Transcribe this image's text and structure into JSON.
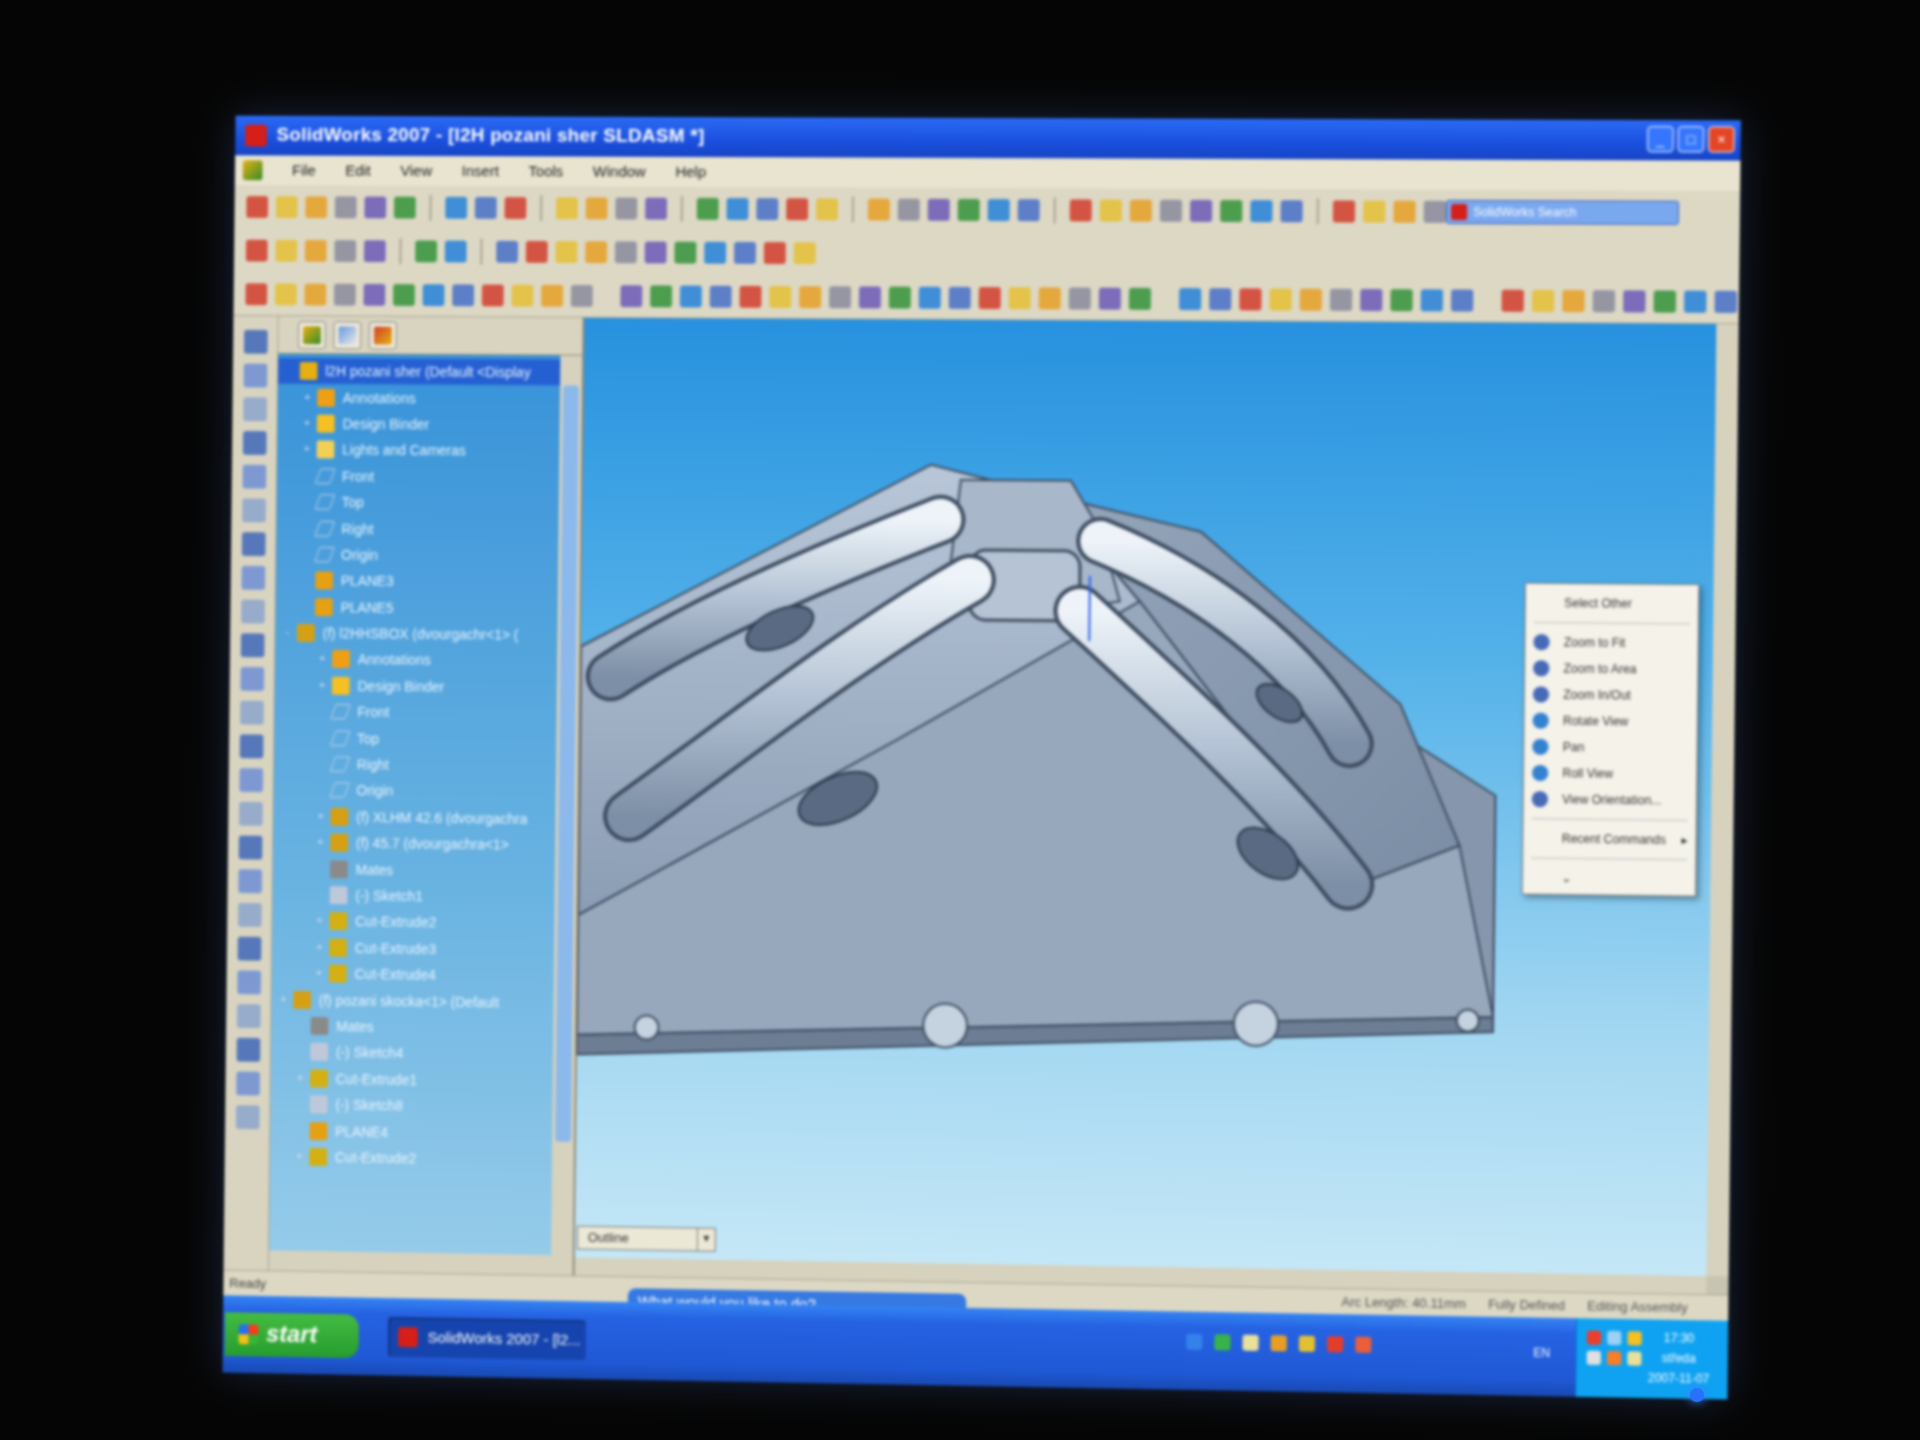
{
  "window": {
    "title": "SolidWorks 2007 - [l2H pozani sher SLDASM *]",
    "controls": [
      "_",
      "□",
      "×"
    ]
  },
  "menu": [
    "File",
    "Edit",
    "View",
    "Insert",
    "Tools",
    "Window",
    "Help"
  ],
  "search_placeholder": "SolidWorks Search",
  "tree": {
    "rows": [
      {
        "label": "l2H pozani sher  (Default <Display",
        "indent": 0,
        "exp": "",
        "icon": "assembly-icon",
        "root": true
      },
      {
        "label": "Annotations",
        "indent": 1,
        "exp": "+",
        "icon": "annotations-icon"
      },
      {
        "label": "Design Binder",
        "indent": 1,
        "exp": "+",
        "icon": "design-binder-icon"
      },
      {
        "label": "Lights and Cameras",
        "indent": 1,
        "exp": "+",
        "icon": "lights-icon"
      },
      {
        "label": "Front",
        "indent": 1,
        "exp": "",
        "icon": "plane-icon"
      },
      {
        "label": "Top",
        "indent": 1,
        "exp": "",
        "icon": "plane-icon"
      },
      {
        "label": "Right",
        "indent": 1,
        "exp": "",
        "icon": "plane-icon"
      },
      {
        "label": "Origin",
        "indent": 1,
        "exp": "",
        "icon": "origin-icon"
      },
      {
        "label": "PLANE3",
        "indent": 1,
        "exp": "",
        "icon": "plane-feature-icon"
      },
      {
        "label": "PLANE5",
        "indent": 1,
        "exp": "",
        "icon": "plane-feature-icon"
      },
      {
        "label": "(f) l2HHSBOX (dvourgachr<1> (",
        "indent": 0,
        "exp": "-",
        "icon": "part-icon"
      },
      {
        "label": "Annotations",
        "indent": 2,
        "exp": "+",
        "icon": "annotations-icon"
      },
      {
        "label": "Design Binder",
        "indent": 2,
        "exp": "+",
        "icon": "design-binder-icon"
      },
      {
        "label": "Front",
        "indent": 2,
        "exp": "",
        "icon": "plane-icon"
      },
      {
        "label": "Top",
        "indent": 2,
        "exp": "",
        "icon": "plane-icon"
      },
      {
        "label": "Right",
        "indent": 2,
        "exp": "",
        "icon": "plane-icon"
      },
      {
        "label": "Origin",
        "indent": 2,
        "exp": "",
        "icon": "origin-icon"
      },
      {
        "label": "(f) XLHM 42.6 (dvourgachra",
        "indent": 2,
        "exp": "+",
        "icon": "part-icon"
      },
      {
        "label": "(f) 45.7 (dvourgachra<1>",
        "indent": 2,
        "exp": "+",
        "icon": "part-icon"
      },
      {
        "label": "Mates",
        "indent": 2,
        "exp": "",
        "icon": "mates-icon"
      },
      {
        "label": "(-) Sketch1",
        "indent": 2,
        "exp": "",
        "icon": "sketch-icon"
      },
      {
        "label": "Cut-Extrude2",
        "indent": 2,
        "exp": "+",
        "icon": "cut-extrude-icon"
      },
      {
        "label": "Cut-Extrude3",
        "indent": 2,
        "exp": "+",
        "icon": "cut-extrude-icon"
      },
      {
        "label": "Cut-Extrude4",
        "indent": 2,
        "exp": "+",
        "icon": "cut-extrude-icon"
      },
      {
        "label": "(f) pozani skocka<1> (Default",
        "indent": 0,
        "exp": "+",
        "icon": "part-icon"
      },
      {
        "label": "Mates",
        "indent": 1,
        "exp": "",
        "icon": "mates-icon"
      },
      {
        "label": "(-) Sketch4",
        "indent": 1,
        "exp": "",
        "icon": "sketch-icon"
      },
      {
        "label": "Cut-Extrude1",
        "indent": 1,
        "exp": "+",
        "icon": "cut-extrude-icon"
      },
      {
        "label": "(-) Sketch8",
        "indent": 1,
        "exp": "",
        "icon": "sketch-icon"
      },
      {
        "label": "PLANE4",
        "indent": 1,
        "exp": "",
        "icon": "plane-feature-icon"
      },
      {
        "label": "Cut-Extrude2",
        "indent": 1,
        "exp": "+",
        "icon": "cut-extrude-icon"
      }
    ]
  },
  "context_menu": {
    "items": [
      {
        "label": "Select Other",
        "icon": "none"
      },
      {
        "sep": true
      },
      {
        "label": "Zoom to Fit",
        "icon": "zoom-fit-icon"
      },
      {
        "label": "Zoom to Area",
        "icon": "zoom-area-icon"
      },
      {
        "label": "Zoom In/Out",
        "icon": "zoom-inout-icon"
      },
      {
        "label": "Rotate View",
        "icon": "rotate-view-icon"
      },
      {
        "label": "Pan",
        "icon": "pan-icon"
      },
      {
        "label": "Roll View",
        "icon": "roll-view-icon"
      },
      {
        "label": "View Orientation...",
        "icon": "view-orientation-icon"
      },
      {
        "sep": true
      },
      {
        "label": "Recent Commands",
        "icon": "none",
        "sub": "▸"
      },
      {
        "sep": true
      },
      {
        "label": "⌄",
        "icon": "none"
      }
    ]
  },
  "graphics": {
    "combo_value": "Outline"
  },
  "statusbar": {
    "left": "Ready",
    "right": [
      "Arc Length: 40.11mm",
      "Fully Defined",
      "Editing Assembly"
    ]
  },
  "assistant_prompt": "What would you like to do?",
  "taskbar": {
    "start_label": "start",
    "task_label": "SolidWorks 2007 - [l2...",
    "lang": "EN",
    "clock_time": "17:30",
    "clock_day": "středa",
    "clock_date": "2007-11-07"
  },
  "colors": {
    "titlebar": "#1f4fd0",
    "viewport_top": "#2f8fd6",
    "viewport_bottom": "#c7e6f4",
    "model_face": "#9aabbf",
    "tree_bg": "#3b8fd0",
    "taskbar": "#2458c8",
    "start": "#2e9a34"
  }
}
